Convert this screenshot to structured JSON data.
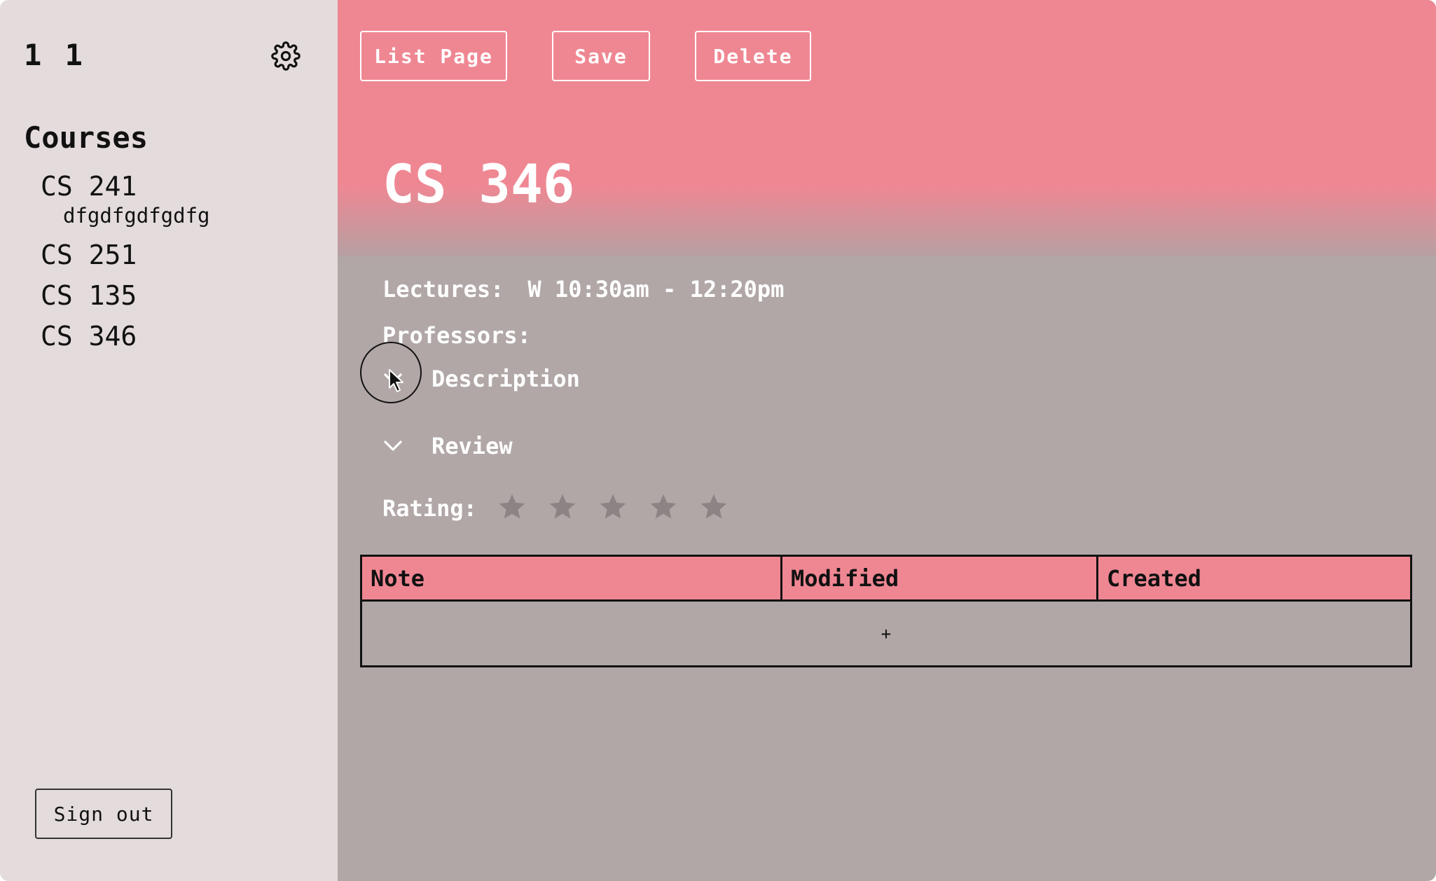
{
  "sidebar": {
    "user_name": "1 1",
    "courses_heading": "Courses",
    "courses": [
      {
        "code": "CS 241",
        "sub": "dfgdfgdfgdfg"
      },
      {
        "code": "CS 251"
      },
      {
        "code": "CS 135"
      },
      {
        "code": "CS 346"
      }
    ],
    "sign_out_label": "Sign out",
    "settings_icon": "gear-icon"
  },
  "toolbar": {
    "list_page_label": "List Page",
    "save_label": "Save",
    "delete_label": "Delete"
  },
  "course": {
    "title": "CS 346",
    "lectures_label": "Lectures:",
    "lectures_value": "W 10:30am - 12:20pm",
    "professors_label": "Professors:",
    "description_label": "Description",
    "review_label": "Review",
    "rating_label": "Rating:",
    "rating_value": 0,
    "rating_max": 5
  },
  "notes_table": {
    "columns": [
      "Note",
      "Modified",
      "Created"
    ],
    "add_label": "+"
  },
  "colors": {
    "accent": "#ef8793",
    "sidebar_bg": "#e3dbdc",
    "main_bg": "#b1a7a7",
    "star_inactive": "#8c8484"
  }
}
